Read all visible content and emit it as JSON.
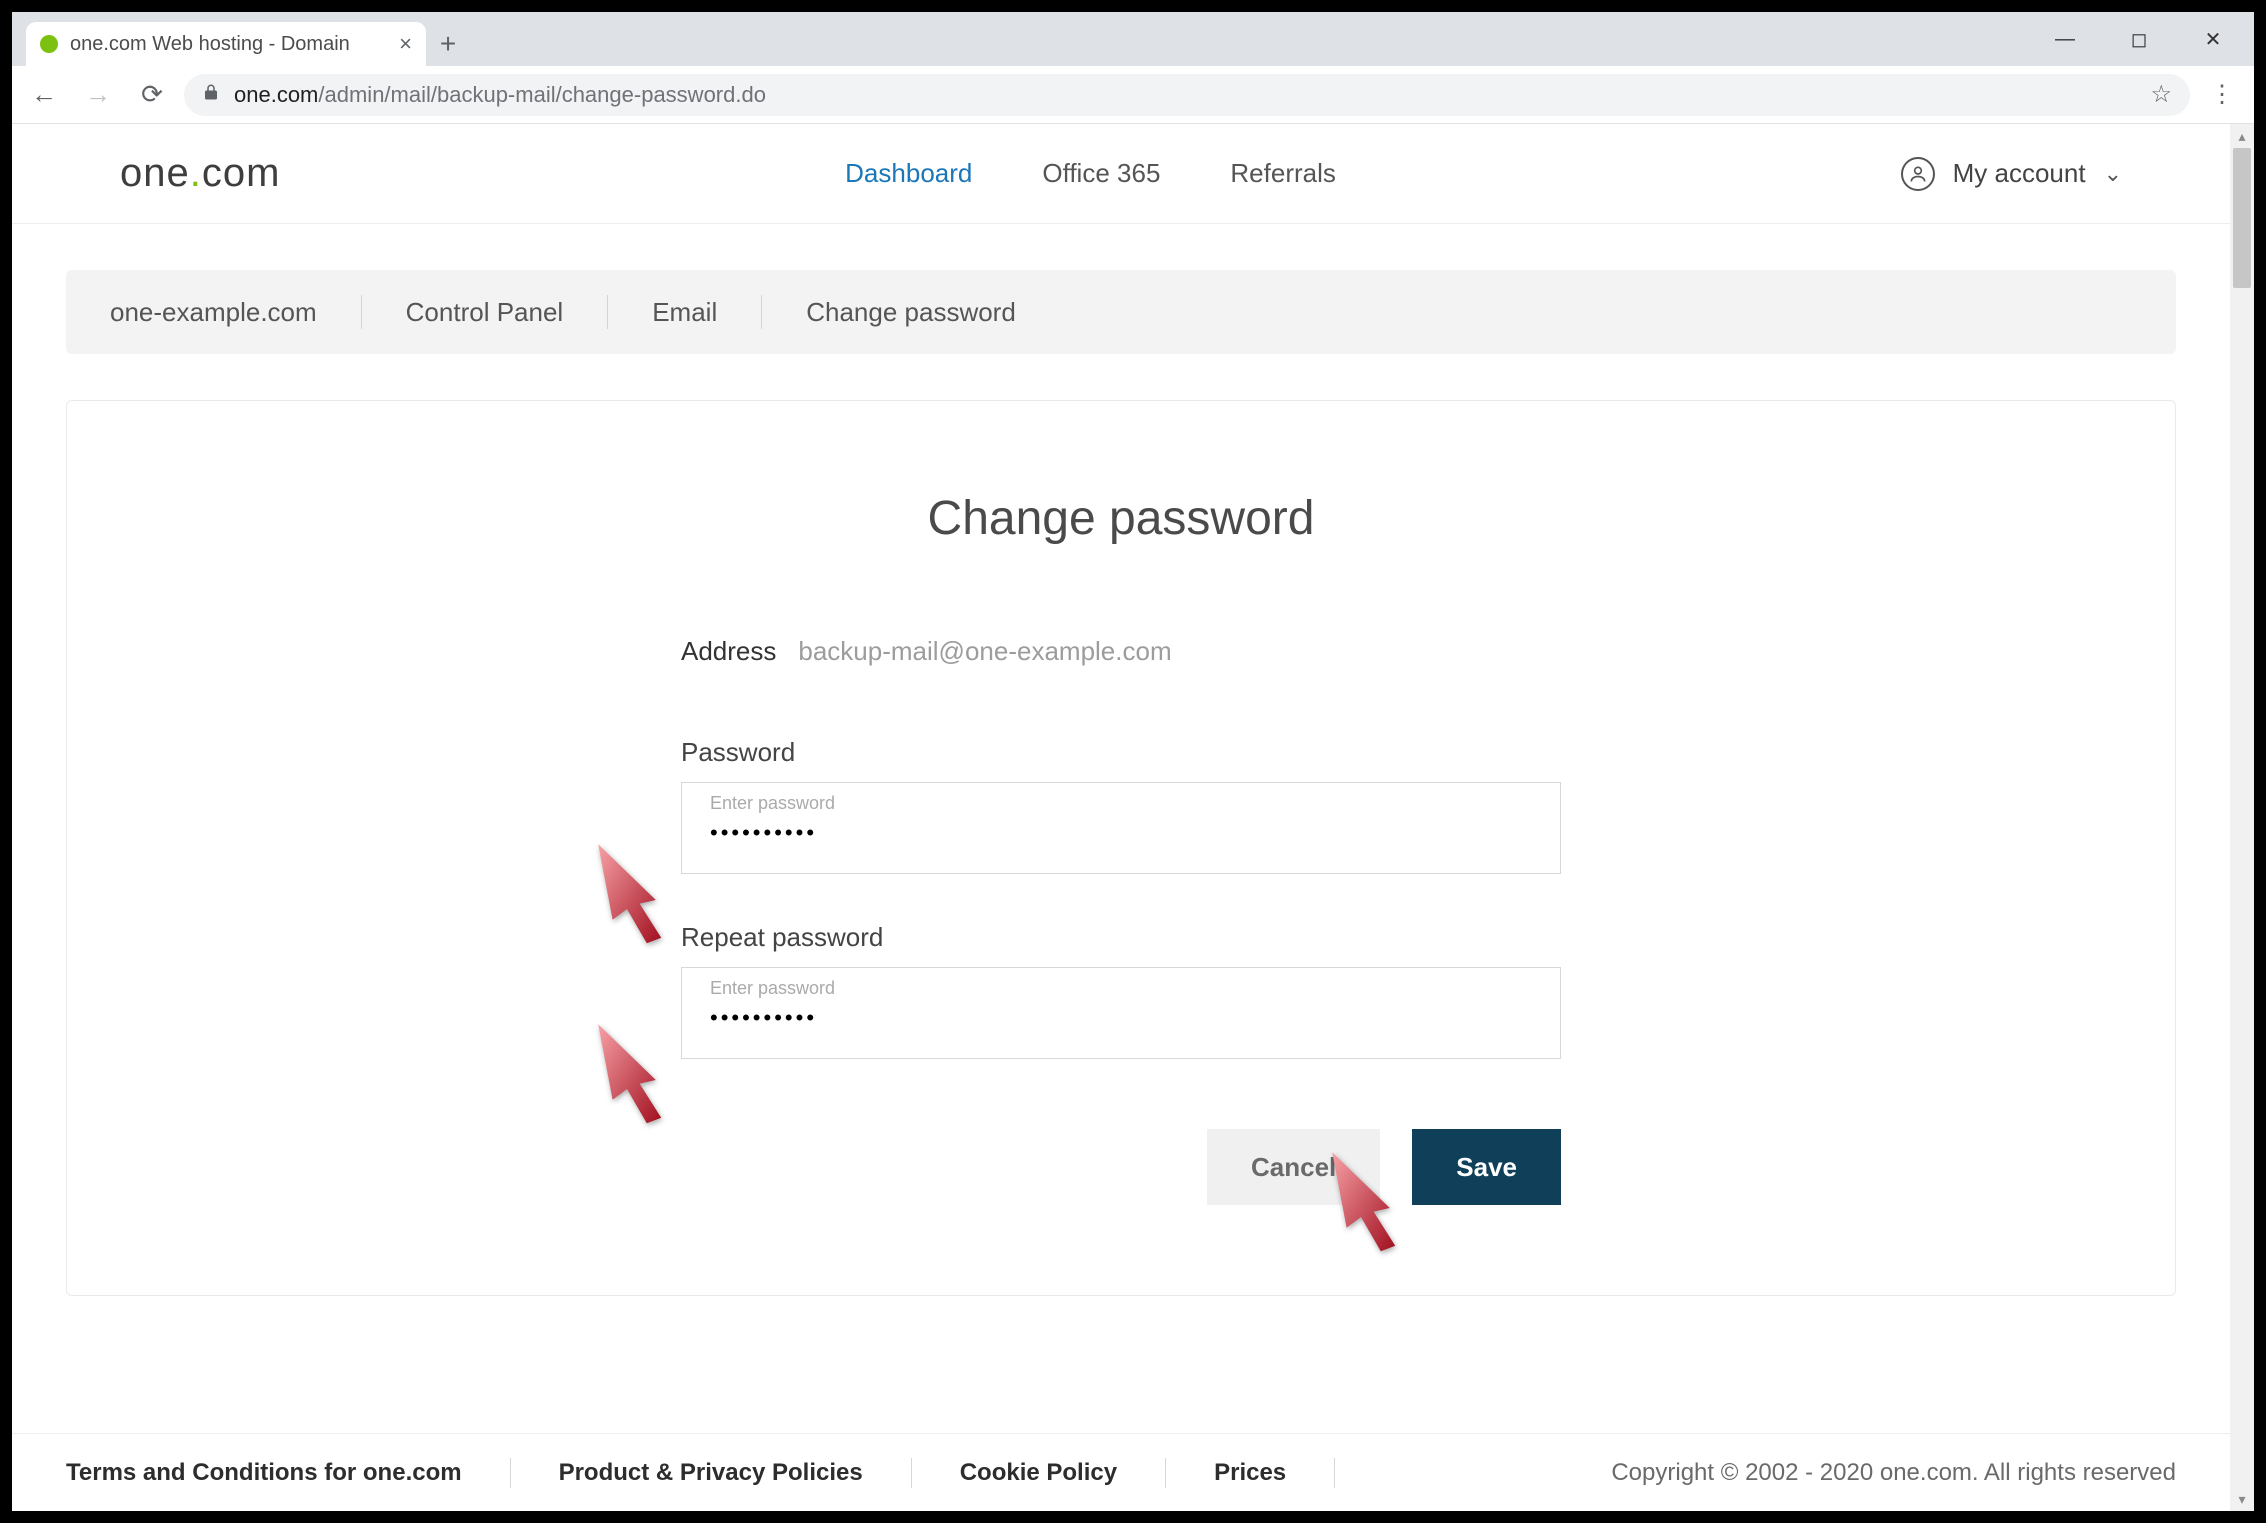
{
  "browser": {
    "tab_title": "one.com Web hosting  -  Domain",
    "url_host": "one.com",
    "url_path": "/admin/mail/backup-mail/change-password.do"
  },
  "header": {
    "logo_pre": "one",
    "logo_dot": ".",
    "logo_post": "com",
    "nav": {
      "dashboard": "Dashboard",
      "office365": "Office 365",
      "referrals": "Referrals"
    },
    "account_label": "My account"
  },
  "breadcrumb": {
    "items": [
      "one-example.com",
      "Control Panel",
      "Email",
      "Change password"
    ]
  },
  "form": {
    "title": "Change password",
    "address_label": "Address",
    "address_value": "backup-mail@one-example.com",
    "password_label": "Password",
    "password_placeholder": "Enter password",
    "password_value": "••••••••••",
    "repeat_label": "Repeat password",
    "repeat_placeholder": "Enter password",
    "repeat_value": "••••••••••",
    "cancel_label": "Cancel",
    "save_label": "Save"
  },
  "footer": {
    "terms": "Terms and Conditions for one.com",
    "privacy": "Product & Privacy Policies",
    "cookie": "Cookie Policy",
    "prices": "Prices",
    "copyright": "Copyright © 2002 - 2020 one.com. All rights reserved"
  }
}
